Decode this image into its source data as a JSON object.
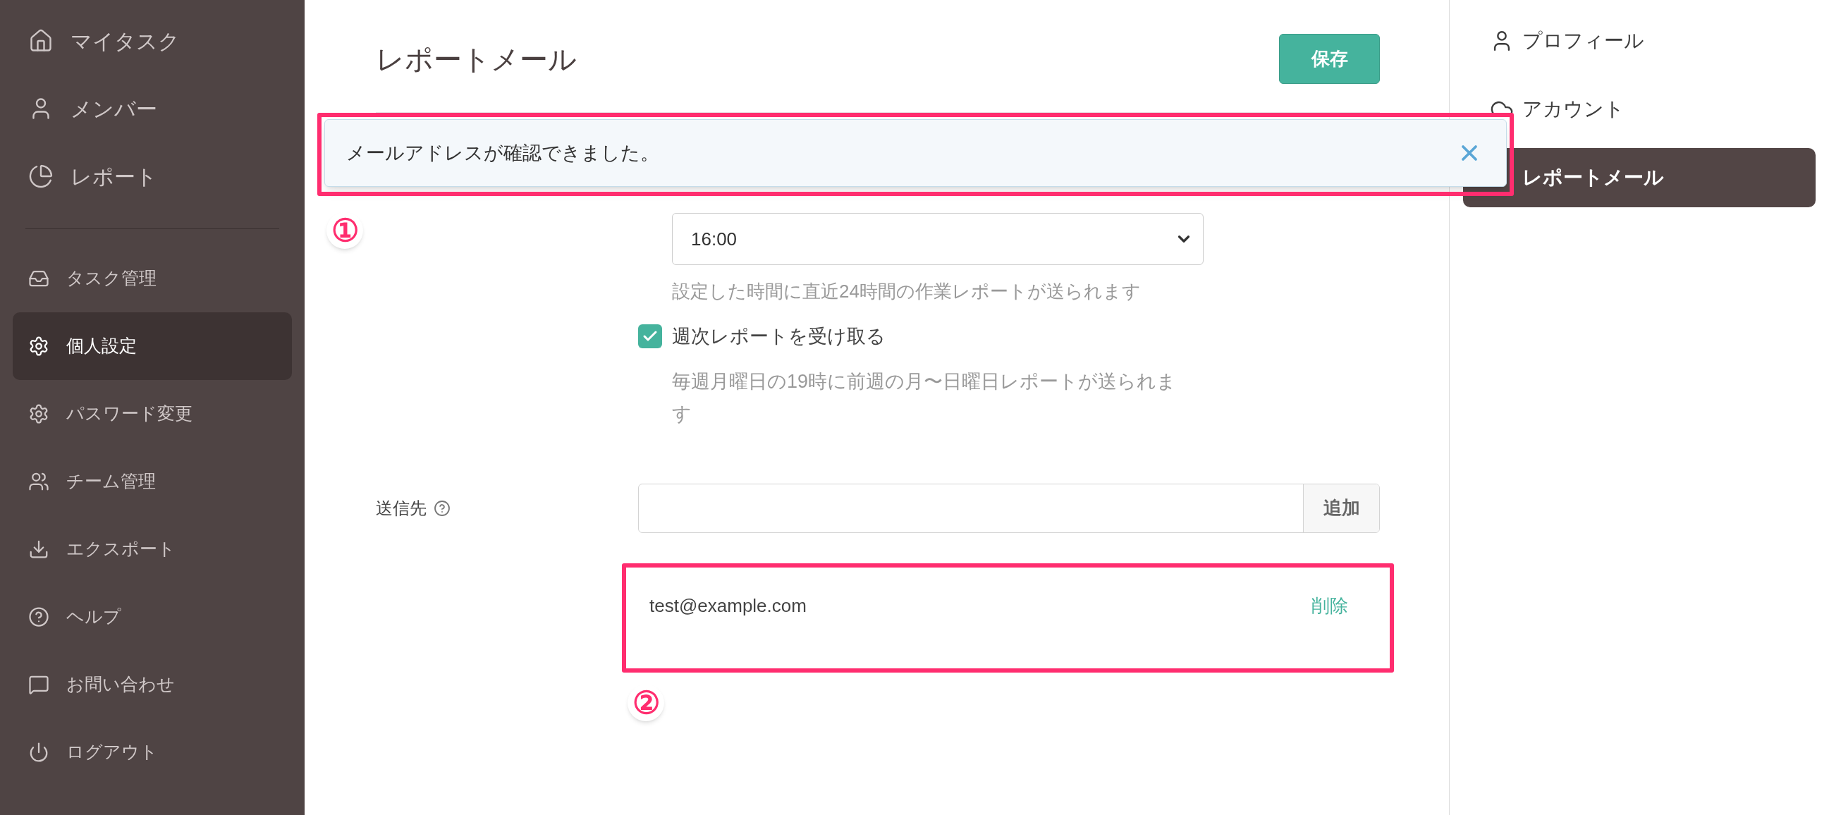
{
  "sidebar": {
    "main_items": [
      {
        "label": "マイタスク",
        "selected": false
      },
      {
        "label": "メンバー",
        "selected": false
      },
      {
        "label": "レポート",
        "selected": false
      }
    ],
    "items": [
      {
        "label": "タスク管理",
        "selected": false
      },
      {
        "label": "個人設定",
        "selected": true
      },
      {
        "label": "パスワード変更",
        "selected": false
      },
      {
        "label": "チーム管理",
        "selected": false
      },
      {
        "label": "エクスポート",
        "selected": false
      },
      {
        "label": "ヘルプ",
        "selected": false
      },
      {
        "label": "お問い合わせ",
        "selected": false
      },
      {
        "label": "ログアウト",
        "selected": false
      }
    ]
  },
  "page": {
    "title": "レポートメール",
    "save_button": "保存"
  },
  "toast": {
    "message": "メールアドレスが確認できました。"
  },
  "daily": {
    "time": "16:00",
    "hint": "設定した時間に直近24時間の作業レポートが送られます"
  },
  "weekly": {
    "label": "週次レポートを受け取る",
    "checked": true,
    "hint": "毎週月曜日の19時に前週の月〜日曜日レポートが送られます"
  },
  "recipients": {
    "label": "送信先",
    "add_button": "追加",
    "emails": [
      {
        "address": "test@example.com",
        "delete": "削除"
      }
    ]
  },
  "settings_menu": [
    {
      "label": "プロフィール",
      "selected": false
    },
    {
      "label": "アカウント",
      "selected": false
    },
    {
      "label": "レポートメール",
      "selected": true
    }
  ],
  "annotations": [
    {
      "label": "①"
    },
    {
      "label": "②"
    }
  ]
}
